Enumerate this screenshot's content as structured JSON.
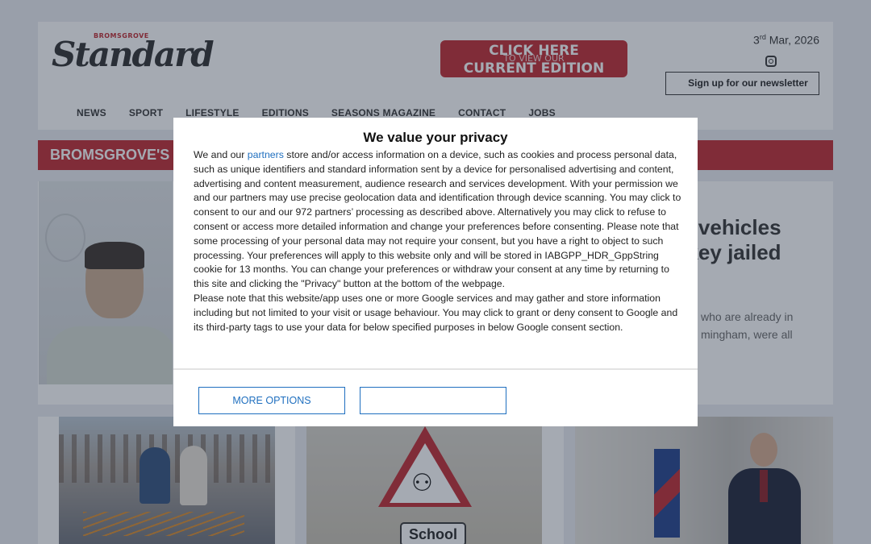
{
  "header": {
    "logo_small": "BROMSGROVE",
    "logo_main": "Standard",
    "cta_line1": "CLICK HERE",
    "cta_line2": "TO VIEW OUR",
    "cta_line3": "CURRENT EDITION",
    "date_day": "3",
    "date_suffix": "rd",
    "date_rest": " Mar, 2026",
    "instagram_icon": "instagram-icon",
    "newsletter_label": "Sign up for our newsletter"
  },
  "nav": {
    "items": [
      "NEWS",
      "SPORT",
      "LIFESTYLE",
      "EDITIONS",
      "SEASONS MAGAZINE",
      "CONTACT",
      "JOBS"
    ]
  },
  "banner": {
    "text": "BROMSGROVE'S N"
  },
  "lead_story": {
    "headline_line1": "le vehicles",
    "headline_line2": "ckey jailed",
    "text_line1": "who are already in",
    "text_line2": "mingham, were all"
  },
  "cards": {
    "card2_sign_text": "School"
  },
  "consent": {
    "title": "We value your privacy",
    "p1_before_link": "We and our ",
    "p1_link": "partners",
    "p1_after_link": " store and/or access information on a device, such as cookies and process personal data, such as unique identifiers and standard information sent by a device for personalised advertising and content, advertising and content measurement, audience research and services development. With your permission we and our partners may use precise geolocation data and identification through device scanning. You may click to consent to our and our 972 partners’ processing as described above. Alternatively you may click to refuse to consent or access more detailed information and change your preferences before consenting. Please note that some processing of your personal data may not require your consent, but you have a right to object to such processing. Your preferences will apply to this website only and will be stored in IABGPP_HDR_GppString cookie for 13 months. You can change your preferences or withdraw your consent at any time by returning to this site and clicking the \"Privacy\" button at the bottom of the webpage.",
    "p2": "Please note that this website/app uses one or more Google services and may gather and store information including but not limited to your visit or usage behaviour. You may click to grant or deny consent to Google and its third-party tags to use your data for below specified purposes in below Google consent section.",
    "more_options_label": "MORE OPTIONS",
    "second_button_label": ""
  }
}
